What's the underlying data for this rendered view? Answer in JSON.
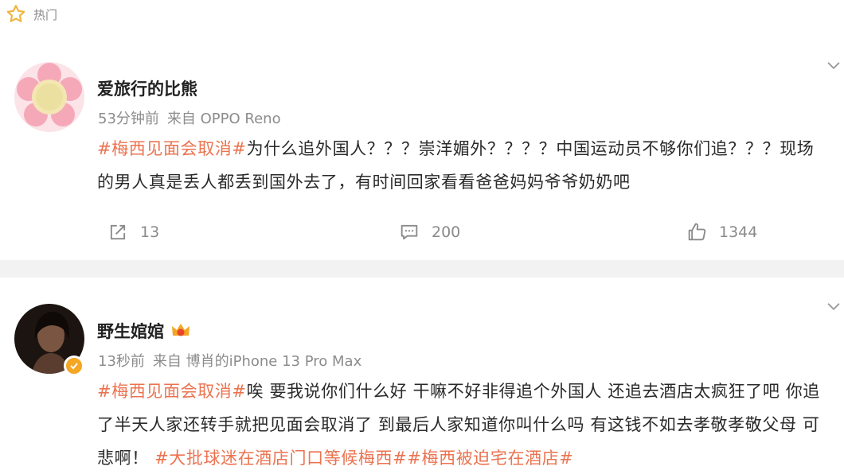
{
  "header": {
    "label": "热门",
    "icon": "star-outline-icon"
  },
  "colors": {
    "accent": "#eb7350",
    "meta": "#8c8c8c",
    "divider": "#f2f2f2",
    "verified": "#f5a623"
  },
  "posts": [
    {
      "username": "爱旅行的比熊",
      "time": "53分钟前",
      "source": "来自 OPPO Reno",
      "hashtag": "#梅西见面会取消#",
      "text": "为什么追外国人？？？崇洋媚外？？？？中国运动员不够你们追？？？现场的男人真是丢人都丢到国外去了，有时间回家看看爸爸妈妈爷爷奶奶吧",
      "reposts": "13",
      "comments": "200",
      "likes": "1344"
    },
    {
      "username": "野生婠婠",
      "time": "13秒前",
      "source": "来自 博肖的iPhone 13 Pro Max",
      "hashtag": "#梅西见面会取消#",
      "text": "唉 要我说你们什么好 干嘛不好非得追个外国人 还追去酒店太疯狂了吧 你追了半天人家还转手就把见面会取消了 到最后人家知道你叫什么吗 有这钱不如去孝敬孝敬父母 可悲啊！",
      "hashtag2": "#大批球迷在酒店门口等候梅西#",
      "hashtag3": "#梅西被迫宅在酒店#"
    }
  ]
}
